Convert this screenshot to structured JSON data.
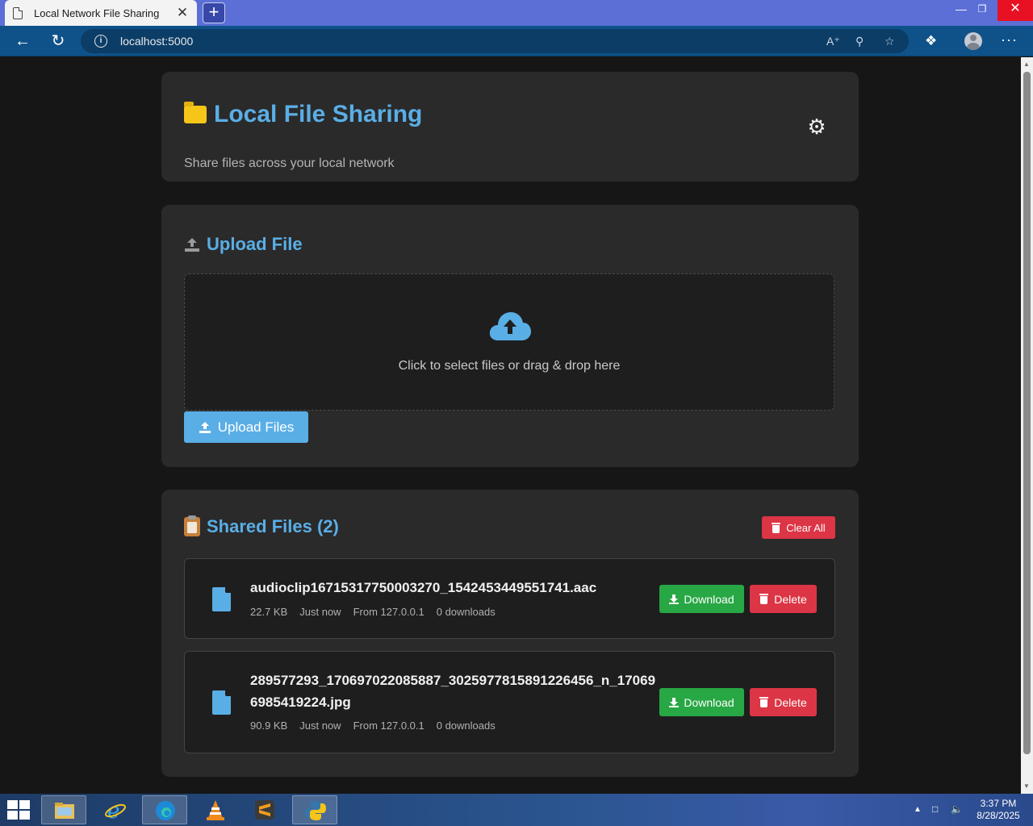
{
  "browser": {
    "tab_title": "Local Network File Sharing",
    "tab_close": "✕",
    "new_tab": "+",
    "url": "localhost:5000",
    "window_controls": {
      "minimize": "—",
      "maximize": "❐",
      "close": "✕"
    }
  },
  "header": {
    "title": "Local File Sharing",
    "subtitle": "Share files across your local network",
    "icon": "folder-icon",
    "settings_icon": "gear-icon"
  },
  "upload": {
    "title": "Upload File",
    "dropzone_text": "Click to select files or drag & drop here",
    "button_label": "Upload Files"
  },
  "shared": {
    "title": "Shared Files (2)",
    "clear_all_label": "Clear All",
    "files": [
      {
        "name": "audioclip16715317750003270_1542453449551741.aac",
        "size": "22.7 KB",
        "time": "Just now",
        "from": "From 127.0.0.1",
        "downloads": "0 downloads",
        "download_label": "Download",
        "delete_label": "Delete"
      },
      {
        "name": "289577293_170697022085887_3025977815891226456_n_170696985419224.jpg",
        "size": "90.9 KB",
        "time": "Just now",
        "from": "From 127.0.0.1",
        "downloads": "0 downloads",
        "download_label": "Download",
        "delete_label": "Delete"
      }
    ]
  },
  "colors": {
    "accent_blue": "#5aaee6",
    "success_green": "#28a745",
    "danger_red": "#dc3545",
    "card_bg": "#2a2a2a",
    "page_bg": "#161616"
  },
  "taskbar": {
    "time": "3:37 PM",
    "date": "8/28/2025"
  }
}
